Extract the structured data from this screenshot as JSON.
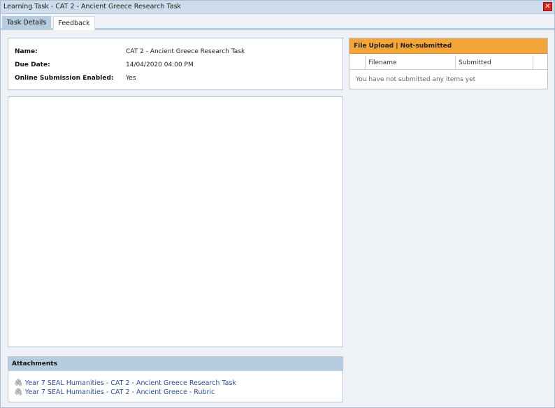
{
  "window": {
    "title": "Learning Task - CAT 2 - Ancient Greece Research Task",
    "close_glyph": "✕"
  },
  "tabs": [
    {
      "label": "Task Details",
      "active": true
    },
    {
      "label": "Feedback",
      "active": false
    }
  ],
  "details": {
    "rows": [
      {
        "label": "Name:",
        "value": "CAT 2 - Ancient Greece Research Task"
      },
      {
        "label": "Due Date:",
        "value": "14/04/2020 04:00 PM"
      },
      {
        "label": "Online Submission Enabled:",
        "value": "Yes"
      }
    ]
  },
  "attachments": {
    "header": "Attachments",
    "items": [
      {
        "label": "Year 7 SEAL Humanities - CAT 2 - Ancient Greece Research Task",
        "icon": "paperclip-icon"
      },
      {
        "label": "Year 7 SEAL Humanities - CAT 2 - Ancient Greece - Rubric",
        "icon": "paperclip-icon"
      }
    ]
  },
  "upload": {
    "header": "File Upload | Not-submitted",
    "columns": [
      "Filename",
      "Submitted"
    ],
    "empty_message": "You have not submitted any items yet"
  },
  "colors": {
    "titlebar": "#cfdceb",
    "tab_active": "#b6ccdf",
    "upload_header": "#f4a53a",
    "link": "#2d4f91",
    "close": "#d9261c"
  }
}
